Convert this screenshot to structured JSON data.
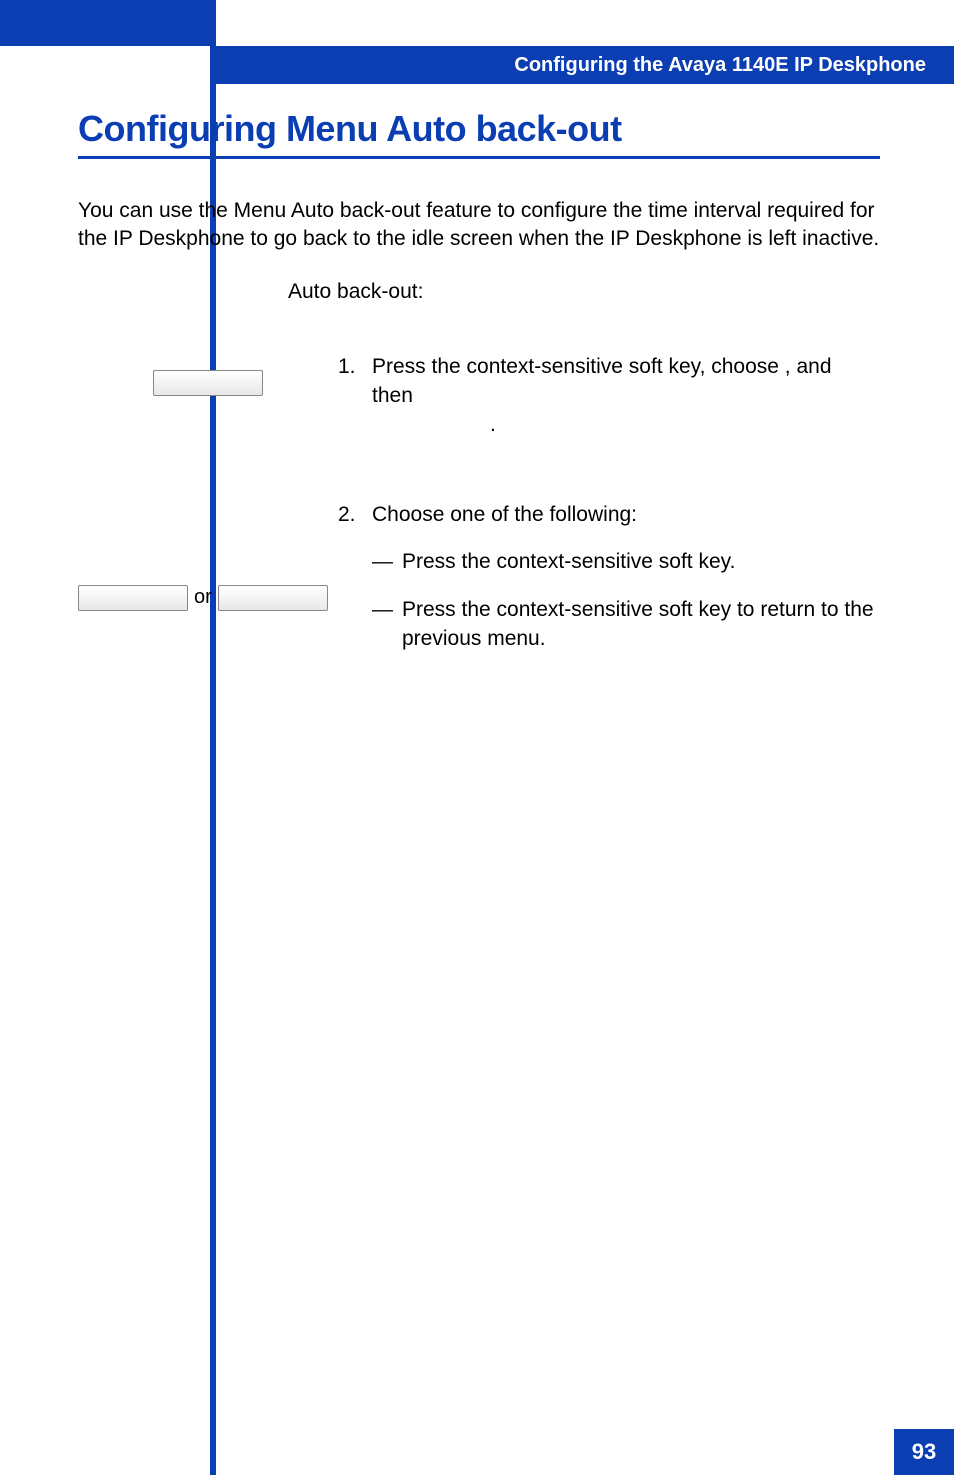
{
  "header": {
    "running_title": "Configuring the Avaya 1140E IP Deskphone"
  },
  "section": {
    "title": "Configuring Menu Auto back-out",
    "intro": "You can use the Menu Auto back-out feature to configure the time interval required for the IP Deskphone to go back to the idle screen when the IP Deskphone is left inactive.",
    "lead_in": "Auto back-out:"
  },
  "steps": {
    "one": {
      "number": "1.",
      "line": "Press the           context-sensitive soft key, choose             , and then",
      "tail": "."
    },
    "two": {
      "number": "2.",
      "line": "Choose one of the following:",
      "sub_a": "Press the            context-sensitive soft key.",
      "sub_b": "Press the          context-sensitive soft key to return to the previous menu."
    }
  },
  "misc": {
    "or_label": "or",
    "dash": "—"
  },
  "page": {
    "number": "93"
  }
}
